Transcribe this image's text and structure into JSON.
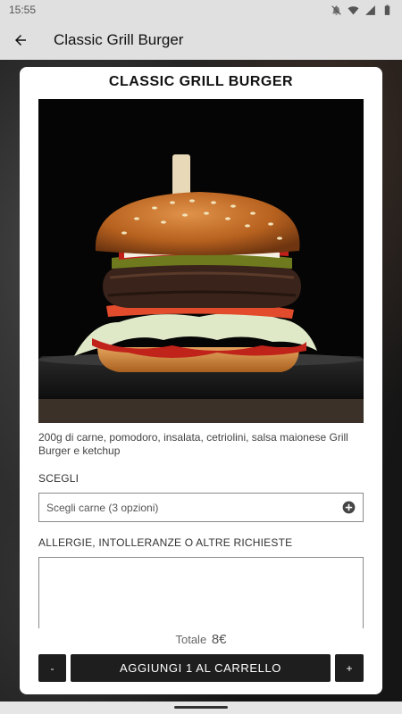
{
  "status_bar": {
    "time": "15:55",
    "icons": [
      "notifications-off-icon",
      "wifi-icon",
      "signal-icon",
      "battery-icon"
    ]
  },
  "app_bar": {
    "title": "Classic Grill Burger",
    "back_icon": "arrow-left-icon"
  },
  "product": {
    "title": "CLASSIC GRILL BURGER",
    "image_subject": "burger-photo",
    "description": "200g di carne, pomodoro, insalata, cetriolini, salsa maionese Grill Burger e ketchup"
  },
  "options": {
    "label": "SCEGLI",
    "select_value": "Scegli carne (3 opzioni)",
    "select_icon": "plus-circle-icon"
  },
  "requests": {
    "label": "ALLERGIE, INTOLLERANZE O ALTRE RICHIESTE",
    "value": ""
  },
  "total": {
    "label": "Totale",
    "price": "8€"
  },
  "actions": {
    "minus_label": "-",
    "add_label": "AGGIUNGI 1 AL CARRELLO",
    "plus_label": "+"
  },
  "colors": {
    "app_bar_bg": "#e0e0e0",
    "button_bg": "#1e1e1e",
    "card_bg": "#ffffff"
  }
}
